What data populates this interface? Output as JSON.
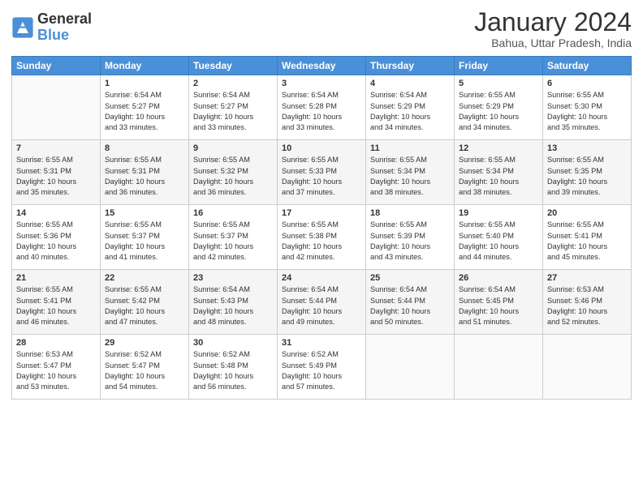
{
  "header": {
    "logo_general": "General",
    "logo_blue": "Blue",
    "month_title": "January 2024",
    "subtitle": "Bahua, Uttar Pradesh, India"
  },
  "days_of_week": [
    "Sunday",
    "Monday",
    "Tuesday",
    "Wednesday",
    "Thursday",
    "Friday",
    "Saturday"
  ],
  "weeks": [
    [
      {
        "num": "",
        "info": ""
      },
      {
        "num": "1",
        "info": "Sunrise: 6:54 AM\nSunset: 5:27 PM\nDaylight: 10 hours\nand 33 minutes."
      },
      {
        "num": "2",
        "info": "Sunrise: 6:54 AM\nSunset: 5:27 PM\nDaylight: 10 hours\nand 33 minutes."
      },
      {
        "num": "3",
        "info": "Sunrise: 6:54 AM\nSunset: 5:28 PM\nDaylight: 10 hours\nand 33 minutes."
      },
      {
        "num": "4",
        "info": "Sunrise: 6:54 AM\nSunset: 5:29 PM\nDaylight: 10 hours\nand 34 minutes."
      },
      {
        "num": "5",
        "info": "Sunrise: 6:55 AM\nSunset: 5:29 PM\nDaylight: 10 hours\nand 34 minutes."
      },
      {
        "num": "6",
        "info": "Sunrise: 6:55 AM\nSunset: 5:30 PM\nDaylight: 10 hours\nand 35 minutes."
      }
    ],
    [
      {
        "num": "7",
        "info": "Sunrise: 6:55 AM\nSunset: 5:31 PM\nDaylight: 10 hours\nand 35 minutes."
      },
      {
        "num": "8",
        "info": "Sunrise: 6:55 AM\nSunset: 5:31 PM\nDaylight: 10 hours\nand 36 minutes."
      },
      {
        "num": "9",
        "info": "Sunrise: 6:55 AM\nSunset: 5:32 PM\nDaylight: 10 hours\nand 36 minutes."
      },
      {
        "num": "10",
        "info": "Sunrise: 6:55 AM\nSunset: 5:33 PM\nDaylight: 10 hours\nand 37 minutes."
      },
      {
        "num": "11",
        "info": "Sunrise: 6:55 AM\nSunset: 5:34 PM\nDaylight: 10 hours\nand 38 minutes."
      },
      {
        "num": "12",
        "info": "Sunrise: 6:55 AM\nSunset: 5:34 PM\nDaylight: 10 hours\nand 38 minutes."
      },
      {
        "num": "13",
        "info": "Sunrise: 6:55 AM\nSunset: 5:35 PM\nDaylight: 10 hours\nand 39 minutes."
      }
    ],
    [
      {
        "num": "14",
        "info": "Sunrise: 6:55 AM\nSunset: 5:36 PM\nDaylight: 10 hours\nand 40 minutes."
      },
      {
        "num": "15",
        "info": "Sunrise: 6:55 AM\nSunset: 5:37 PM\nDaylight: 10 hours\nand 41 minutes."
      },
      {
        "num": "16",
        "info": "Sunrise: 6:55 AM\nSunset: 5:37 PM\nDaylight: 10 hours\nand 42 minutes."
      },
      {
        "num": "17",
        "info": "Sunrise: 6:55 AM\nSunset: 5:38 PM\nDaylight: 10 hours\nand 42 minutes."
      },
      {
        "num": "18",
        "info": "Sunrise: 6:55 AM\nSunset: 5:39 PM\nDaylight: 10 hours\nand 43 minutes."
      },
      {
        "num": "19",
        "info": "Sunrise: 6:55 AM\nSunset: 5:40 PM\nDaylight: 10 hours\nand 44 minutes."
      },
      {
        "num": "20",
        "info": "Sunrise: 6:55 AM\nSunset: 5:41 PM\nDaylight: 10 hours\nand 45 minutes."
      }
    ],
    [
      {
        "num": "21",
        "info": "Sunrise: 6:55 AM\nSunset: 5:41 PM\nDaylight: 10 hours\nand 46 minutes."
      },
      {
        "num": "22",
        "info": "Sunrise: 6:55 AM\nSunset: 5:42 PM\nDaylight: 10 hours\nand 47 minutes."
      },
      {
        "num": "23",
        "info": "Sunrise: 6:54 AM\nSunset: 5:43 PM\nDaylight: 10 hours\nand 48 minutes."
      },
      {
        "num": "24",
        "info": "Sunrise: 6:54 AM\nSunset: 5:44 PM\nDaylight: 10 hours\nand 49 minutes."
      },
      {
        "num": "25",
        "info": "Sunrise: 6:54 AM\nSunset: 5:44 PM\nDaylight: 10 hours\nand 50 minutes."
      },
      {
        "num": "26",
        "info": "Sunrise: 6:54 AM\nSunset: 5:45 PM\nDaylight: 10 hours\nand 51 minutes."
      },
      {
        "num": "27",
        "info": "Sunrise: 6:53 AM\nSunset: 5:46 PM\nDaylight: 10 hours\nand 52 minutes."
      }
    ],
    [
      {
        "num": "28",
        "info": "Sunrise: 6:53 AM\nSunset: 5:47 PM\nDaylight: 10 hours\nand 53 minutes."
      },
      {
        "num": "29",
        "info": "Sunrise: 6:52 AM\nSunset: 5:47 PM\nDaylight: 10 hours\nand 54 minutes."
      },
      {
        "num": "30",
        "info": "Sunrise: 6:52 AM\nSunset: 5:48 PM\nDaylight: 10 hours\nand 56 minutes."
      },
      {
        "num": "31",
        "info": "Sunrise: 6:52 AM\nSunset: 5:49 PM\nDaylight: 10 hours\nand 57 minutes."
      },
      {
        "num": "",
        "info": ""
      },
      {
        "num": "",
        "info": ""
      },
      {
        "num": "",
        "info": ""
      }
    ]
  ]
}
